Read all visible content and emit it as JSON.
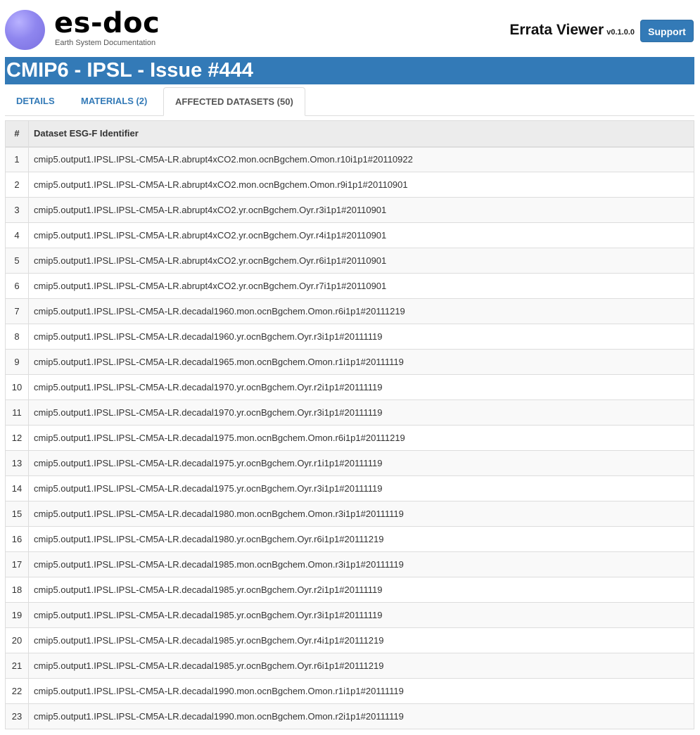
{
  "header": {
    "logo_text": "es-doc",
    "logo_subtitle": "Earth System Documentation",
    "app_name": "Errata Viewer",
    "version": "v0.1.0.0",
    "support_label": "Support"
  },
  "banner": {
    "title": "CMIP6 - IPSL - Issue #444"
  },
  "tabs": [
    {
      "label": "DETAILS",
      "active": false
    },
    {
      "label": "MATERIALS (2)",
      "active": false
    },
    {
      "label": "AFFECTED DATASETS (50)",
      "active": true
    }
  ],
  "table": {
    "columns": [
      "#",
      "Dataset ESG-F Identifier"
    ],
    "rows": [
      {
        "n": "1",
        "id": "cmip5.output1.IPSL.IPSL-CM5A-LR.abrupt4xCO2.mon.ocnBgchem.Omon.r10i1p1#20110922"
      },
      {
        "n": "2",
        "id": "cmip5.output1.IPSL.IPSL-CM5A-LR.abrupt4xCO2.mon.ocnBgchem.Omon.r9i1p1#20110901"
      },
      {
        "n": "3",
        "id": "cmip5.output1.IPSL.IPSL-CM5A-LR.abrupt4xCO2.yr.ocnBgchem.Oyr.r3i1p1#20110901"
      },
      {
        "n": "4",
        "id": "cmip5.output1.IPSL.IPSL-CM5A-LR.abrupt4xCO2.yr.ocnBgchem.Oyr.r4i1p1#20110901"
      },
      {
        "n": "5",
        "id": "cmip5.output1.IPSL.IPSL-CM5A-LR.abrupt4xCO2.yr.ocnBgchem.Oyr.r6i1p1#20110901"
      },
      {
        "n": "6",
        "id": "cmip5.output1.IPSL.IPSL-CM5A-LR.abrupt4xCO2.yr.ocnBgchem.Oyr.r7i1p1#20110901"
      },
      {
        "n": "7",
        "id": "cmip5.output1.IPSL.IPSL-CM5A-LR.decadal1960.mon.ocnBgchem.Omon.r6i1p1#20111219"
      },
      {
        "n": "8",
        "id": "cmip5.output1.IPSL.IPSL-CM5A-LR.decadal1960.yr.ocnBgchem.Oyr.r3i1p1#20111119"
      },
      {
        "n": "9",
        "id": "cmip5.output1.IPSL.IPSL-CM5A-LR.decadal1965.mon.ocnBgchem.Omon.r1i1p1#20111119"
      },
      {
        "n": "10",
        "id": "cmip5.output1.IPSL.IPSL-CM5A-LR.decadal1970.yr.ocnBgchem.Oyr.r2i1p1#20111119"
      },
      {
        "n": "11",
        "id": "cmip5.output1.IPSL.IPSL-CM5A-LR.decadal1970.yr.ocnBgchem.Oyr.r3i1p1#20111119"
      },
      {
        "n": "12",
        "id": "cmip5.output1.IPSL.IPSL-CM5A-LR.decadal1975.mon.ocnBgchem.Omon.r6i1p1#20111219"
      },
      {
        "n": "13",
        "id": "cmip5.output1.IPSL.IPSL-CM5A-LR.decadal1975.yr.ocnBgchem.Oyr.r1i1p1#20111119"
      },
      {
        "n": "14",
        "id": "cmip5.output1.IPSL.IPSL-CM5A-LR.decadal1975.yr.ocnBgchem.Oyr.r3i1p1#20111119"
      },
      {
        "n": "15",
        "id": "cmip5.output1.IPSL.IPSL-CM5A-LR.decadal1980.mon.ocnBgchem.Omon.r3i1p1#20111119"
      },
      {
        "n": "16",
        "id": "cmip5.output1.IPSL.IPSL-CM5A-LR.decadal1980.yr.ocnBgchem.Oyr.r6i1p1#20111219"
      },
      {
        "n": "17",
        "id": "cmip5.output1.IPSL.IPSL-CM5A-LR.decadal1985.mon.ocnBgchem.Omon.r3i1p1#20111119"
      },
      {
        "n": "18",
        "id": "cmip5.output1.IPSL.IPSL-CM5A-LR.decadal1985.yr.ocnBgchem.Oyr.r2i1p1#20111119"
      },
      {
        "n": "19",
        "id": "cmip5.output1.IPSL.IPSL-CM5A-LR.decadal1985.yr.ocnBgchem.Oyr.r3i1p1#20111119"
      },
      {
        "n": "20",
        "id": "cmip5.output1.IPSL.IPSL-CM5A-LR.decadal1985.yr.ocnBgchem.Oyr.r4i1p1#20111219"
      },
      {
        "n": "21",
        "id": "cmip5.output1.IPSL.IPSL-CM5A-LR.decadal1985.yr.ocnBgchem.Oyr.r6i1p1#20111219"
      },
      {
        "n": "22",
        "id": "cmip5.output1.IPSL.IPSL-CM5A-LR.decadal1990.mon.ocnBgchem.Omon.r1i1p1#20111119"
      },
      {
        "n": "23",
        "id": "cmip5.output1.IPSL.IPSL-CM5A-LR.decadal1990.mon.ocnBgchem.Omon.r2i1p1#20111119"
      }
    ]
  },
  "colors": {
    "primary": "#337ab7",
    "logo": "#8f86ef",
    "header_row_bg": "#ececec",
    "stripe_bg": "#f9f9f9",
    "border": "#dddddd"
  }
}
